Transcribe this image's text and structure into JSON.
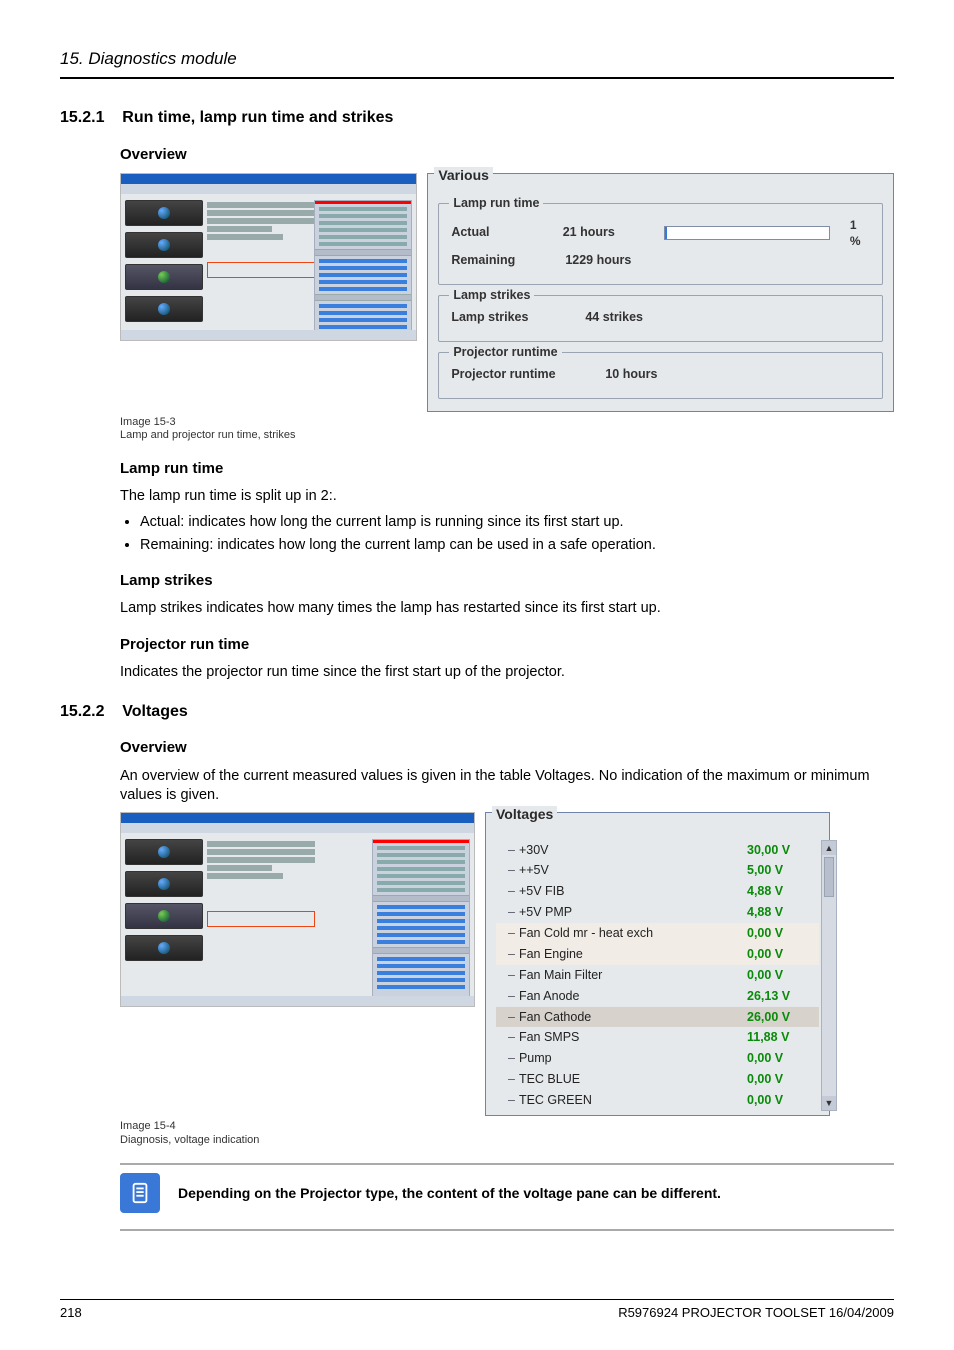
{
  "chapter_head": "15.  Diagnostics module",
  "s1": {
    "num": "15.2.1",
    "title": "Run time, lamp run time and strikes",
    "overview_h": "Overview",
    "caption_id": "Image 15-3",
    "caption_txt": "Lamp and projector run time, strikes",
    "gui": {
      "group_title": "Various",
      "lamp_run_legend": "Lamp run time",
      "actual_label": "Actual",
      "actual_value": "21 hours",
      "remaining_label": "Remaining",
      "remaining_value": "1229 hours",
      "pct": "1 %",
      "strikes_legend": "Lamp strikes",
      "strikes_label": "Lamp strikes",
      "strikes_value": "44 strikes",
      "proj_legend": "Projector runtime",
      "proj_label": "Projector runtime",
      "proj_value": "10 hours"
    },
    "lrt_h": "Lamp run time",
    "lrt_p": "The lamp run time is split up in 2:.",
    "lrt_b1": "Actual: indicates how long the current lamp is running since its first start up.",
    "lrt_b2": "Remaining: indicates how long the current lamp can be used in a safe operation.",
    "ls_h": "Lamp strikes",
    "ls_p": "Lamp strikes indicates how many times the lamp has restarted since its first start up.",
    "prt_h": "Projector run time",
    "prt_p": "Indicates the projector run time since the first start up of the projector."
  },
  "s2": {
    "num": "15.2.2",
    "title": "Voltages",
    "overview_h": "Overview",
    "overview_p": "An overview of the current measured values is given in the table Voltages. No indication of the maximum or minimum values is given.",
    "caption_id": "Image 15-4",
    "caption_txt": "Diagnosis, voltage indication",
    "gui_title": "Voltages",
    "rows": [
      {
        "lbl": "+30V",
        "val": "30,00 V"
      },
      {
        "lbl": "++5V",
        "val": "5,00 V"
      },
      {
        "lbl": "+5V FIB",
        "val": "4,88 V"
      },
      {
        "lbl": "+5V PMP",
        "val": "4,88 V"
      },
      {
        "lbl": "Fan Cold mr - heat exch",
        "val": "0,00 V"
      },
      {
        "lbl": "Fan Engine",
        "val": "0,00 V"
      },
      {
        "lbl": "Fan Main Filter",
        "val": "0,00 V"
      },
      {
        "lbl": "Fan Anode",
        "val": "26,13 V"
      },
      {
        "lbl": "Fan Cathode",
        "val": "26,00 V"
      },
      {
        "lbl": "Fan SMPS",
        "val": "11,88 V"
      },
      {
        "lbl": "Pump",
        "val": "0,00 V"
      },
      {
        "lbl": "TEC BLUE",
        "val": "0,00 V"
      },
      {
        "lbl": "TEC GREEN",
        "val": "0,00 V"
      }
    ]
  },
  "note": "Depending on the Projector type, the content of the voltage pane can be different.",
  "footer": {
    "page": "218",
    "doc": "R5976924   PROJECTOR TOOLSET  16/04/2009"
  }
}
